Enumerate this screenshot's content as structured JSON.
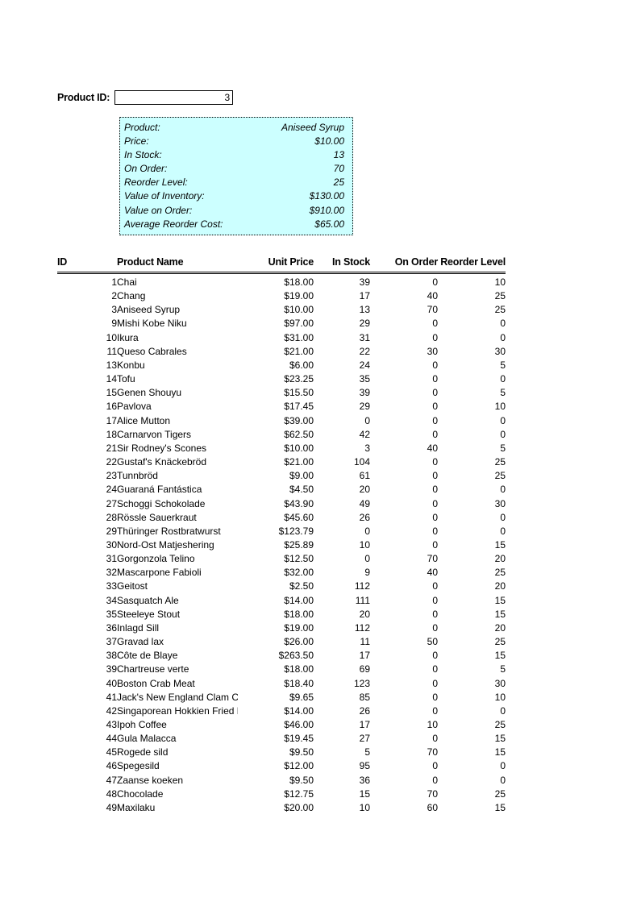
{
  "form": {
    "label": "Product ID:",
    "value": "3",
    "placeholder": ""
  },
  "info_box": {
    "accent_color": "#ccffff",
    "rows": [
      {
        "label": "Product:",
        "value": "Aniseed Syrup"
      },
      {
        "label": "Price:",
        "value": "$10.00"
      },
      {
        "label": "In Stock:",
        "value": "13"
      },
      {
        "label": "On Order:",
        "value": "70"
      },
      {
        "label": "Reorder Level:",
        "value": "25"
      },
      {
        "label": "Value of Inventory:",
        "value": "$130.00"
      },
      {
        "label": "Value on Order:",
        "value": "$910.00"
      },
      {
        "label": "Average Reorder Cost:",
        "value": "$65.00"
      }
    ]
  },
  "table": {
    "columns": [
      "ID",
      "Product Name",
      "Unit Price",
      "In Stock",
      "On Order",
      "Reorder Level"
    ],
    "rows": [
      {
        "id": "1",
        "name": "Chai",
        "price": "$18.00",
        "stock": "39",
        "on_order": "0",
        "reorder": "10"
      },
      {
        "id": "2",
        "name": "Chang",
        "price": "$19.00",
        "stock": "17",
        "on_order": "40",
        "reorder": "25"
      },
      {
        "id": "3",
        "name": "Aniseed Syrup",
        "price": "$10.00",
        "stock": "13",
        "on_order": "70",
        "reorder": "25"
      },
      {
        "id": "9",
        "name": "Mishi Kobe Niku",
        "price": "$97.00",
        "stock": "29",
        "on_order": "0",
        "reorder": "0"
      },
      {
        "id": "10",
        "name": "Ikura",
        "price": "$31.00",
        "stock": "31",
        "on_order": "0",
        "reorder": "0"
      },
      {
        "id": "11",
        "name": "Queso Cabrales",
        "price": "$21.00",
        "stock": "22",
        "on_order": "30",
        "reorder": "30"
      },
      {
        "id": "13",
        "name": "Konbu",
        "price": "$6.00",
        "stock": "24",
        "on_order": "0",
        "reorder": "5"
      },
      {
        "id": "14",
        "name": "Tofu",
        "price": "$23.25",
        "stock": "35",
        "on_order": "0",
        "reorder": "0"
      },
      {
        "id": "15",
        "name": "Genen Shouyu",
        "price": "$15.50",
        "stock": "39",
        "on_order": "0",
        "reorder": "5"
      },
      {
        "id": "16",
        "name": "Pavlova",
        "price": "$17.45",
        "stock": "29",
        "on_order": "0",
        "reorder": "10"
      },
      {
        "id": "17",
        "name": "Alice Mutton",
        "price": "$39.00",
        "stock": "0",
        "on_order": "0",
        "reorder": "0"
      },
      {
        "id": "18",
        "name": "Carnarvon Tigers",
        "price": "$62.50",
        "stock": "42",
        "on_order": "0",
        "reorder": "0"
      },
      {
        "id": "21",
        "name": "Sir Rodney's Scones",
        "price": "$10.00",
        "stock": "3",
        "on_order": "40",
        "reorder": "5"
      },
      {
        "id": "22",
        "name": "Gustaf's Knäckebröd",
        "price": "$21.00",
        "stock": "104",
        "on_order": "0",
        "reorder": "25"
      },
      {
        "id": "23",
        "name": "Tunnbröd",
        "price": "$9.00",
        "stock": "61",
        "on_order": "0",
        "reorder": "25"
      },
      {
        "id": "24",
        "name": "Guaraná Fantástica",
        "price": "$4.50",
        "stock": "20",
        "on_order": "0",
        "reorder": "0"
      },
      {
        "id": "27",
        "name": "Schoggi Schokolade",
        "price": "$43.90",
        "stock": "49",
        "on_order": "0",
        "reorder": "30"
      },
      {
        "id": "28",
        "name": "Rössle Sauerkraut",
        "price": "$45.60",
        "stock": "26",
        "on_order": "0",
        "reorder": "0"
      },
      {
        "id": "29",
        "name": "Thüringer Rostbratwurst",
        "price": "$123.79",
        "stock": "0",
        "on_order": "0",
        "reorder": "0"
      },
      {
        "id": "30",
        "name": "Nord-Ost Matjeshering",
        "price": "$25.89",
        "stock": "10",
        "on_order": "0",
        "reorder": "15"
      },
      {
        "id": "31",
        "name": "Gorgonzola Telino",
        "price": "$12.50",
        "stock": "0",
        "on_order": "70",
        "reorder": "20"
      },
      {
        "id": "32",
        "name": "Mascarpone Fabioli",
        "price": "$32.00",
        "stock": "9",
        "on_order": "40",
        "reorder": "25"
      },
      {
        "id": "33",
        "name": "Geitost",
        "price": "$2.50",
        "stock": "112",
        "on_order": "0",
        "reorder": "20"
      },
      {
        "id": "34",
        "name": "Sasquatch Ale",
        "price": "$14.00",
        "stock": "111",
        "on_order": "0",
        "reorder": "15"
      },
      {
        "id": "35",
        "name": "Steeleye Stout",
        "price": "$18.00",
        "stock": "20",
        "on_order": "0",
        "reorder": "15"
      },
      {
        "id": "36",
        "name": "Inlagd Sill",
        "price": "$19.00",
        "stock": "112",
        "on_order": "0",
        "reorder": "20"
      },
      {
        "id": "37",
        "name": "Gravad lax",
        "price": "$26.00",
        "stock": "11",
        "on_order": "50",
        "reorder": "25"
      },
      {
        "id": "38",
        "name": "Côte de Blaye",
        "price": "$263.50",
        "stock": "17",
        "on_order": "0",
        "reorder": "15"
      },
      {
        "id": "39",
        "name": "Chartreuse verte",
        "price": "$18.00",
        "stock": "69",
        "on_order": "0",
        "reorder": "5"
      },
      {
        "id": "40",
        "name": "Boston Crab Meat",
        "price": "$18.40",
        "stock": "123",
        "on_order": "0",
        "reorder": "30"
      },
      {
        "id": "41",
        "name": "Jack's New England Clam Chowder",
        "price": "$9.65",
        "stock": "85",
        "on_order": "0",
        "reorder": "10"
      },
      {
        "id": "42",
        "name": "Singaporean Hokkien Fried Mee",
        "price": "$14.00",
        "stock": "26",
        "on_order": "0",
        "reorder": "0"
      },
      {
        "id": "43",
        "name": "Ipoh Coffee",
        "price": "$46.00",
        "stock": "17",
        "on_order": "10",
        "reorder": "25"
      },
      {
        "id": "44",
        "name": "Gula Malacca",
        "price": "$19.45",
        "stock": "27",
        "on_order": "0",
        "reorder": "15"
      },
      {
        "id": "45",
        "name": "Rogede sild",
        "price": "$9.50",
        "stock": "5",
        "on_order": "70",
        "reorder": "15"
      },
      {
        "id": "46",
        "name": "Spegesild",
        "price": "$12.00",
        "stock": "95",
        "on_order": "0",
        "reorder": "0"
      },
      {
        "id": "47",
        "name": "Zaanse koeken",
        "price": "$9.50",
        "stock": "36",
        "on_order": "0",
        "reorder": "0"
      },
      {
        "id": "48",
        "name": "Chocolade",
        "price": "$12.75",
        "stock": "15",
        "on_order": "70",
        "reorder": "25"
      },
      {
        "id": "49",
        "name": "Maxilaku",
        "price": "$20.00",
        "stock": "10",
        "on_order": "60",
        "reorder": "15"
      }
    ]
  }
}
